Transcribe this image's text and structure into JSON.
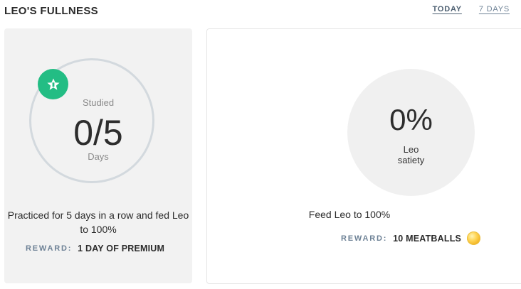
{
  "header": {
    "title": "LEO'S FULLNESS",
    "tabs": [
      {
        "label": "TODAY",
        "active": true
      },
      {
        "label": "7 DAYS",
        "active": false
      }
    ]
  },
  "streak_card": {
    "top_label": "Studied",
    "progress": "0/5",
    "progress_value": 0,
    "progress_goal": 5,
    "unit": "Days",
    "description": "Practiced for 5 days in a row and fed Leo to 100%",
    "reward_label": "REWARD:",
    "reward_value": "1 DAY OF PREMIUM",
    "badge_icon": "star-icon"
  },
  "satiety_card": {
    "percent": "0%",
    "caption_line1": "Leo",
    "caption_line2": "satiety",
    "description": "Feed Leo to 100%",
    "reward_label": "REWARD:",
    "reward_value": "10 MEATBALLS",
    "reward_icon": "meatball-icon"
  },
  "colors": {
    "accent_green": "#23bd84",
    "label_gray_blue": "#6e8296",
    "ring_gray": "#d3d9de",
    "card_bg": "#f2f2f2"
  }
}
